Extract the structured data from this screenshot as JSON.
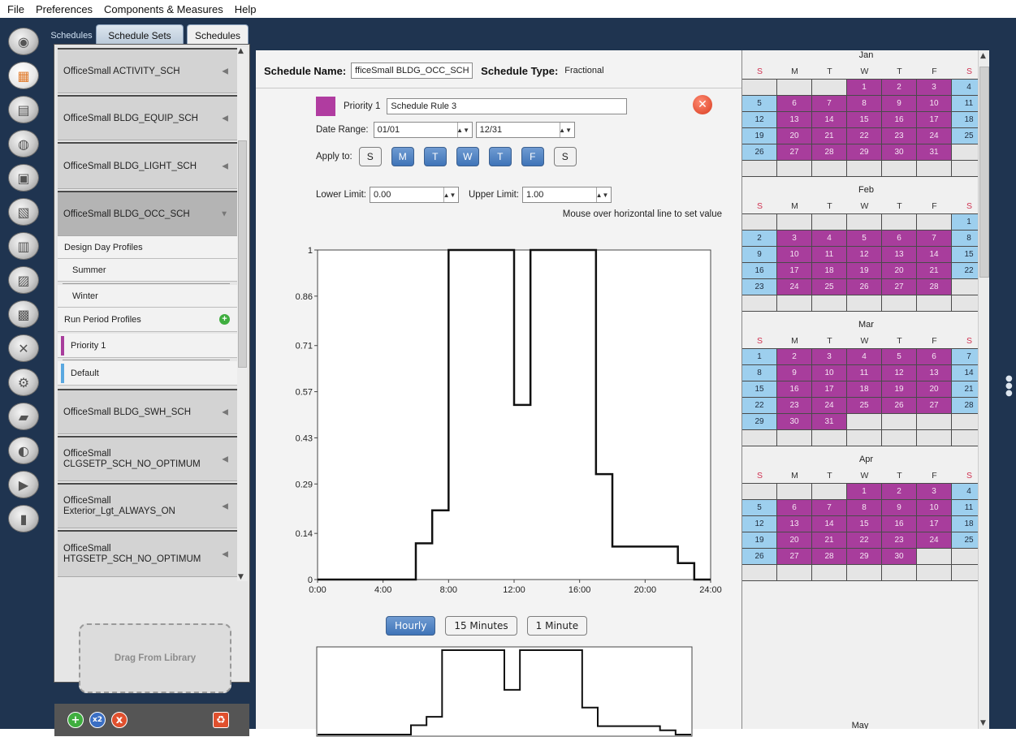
{
  "menu": [
    "File",
    "Preferences",
    "Components & Measures",
    "Help"
  ],
  "tabs": {
    "top_label": "Schedules",
    "schedule_sets": "Schedule Sets",
    "schedules": "Schedules"
  },
  "nav_icons": [
    "site-icon",
    "schedules-icon",
    "constructions-icon",
    "loads-icon",
    "space-types-icon",
    "geometry-icon",
    "facility-icon",
    "spaces-icon",
    "thermal-zones-icon",
    "hvac-systems-icon",
    "outputs-icon",
    "simulation-settings-icon",
    "measures-icon",
    "run-icon",
    "results-icon"
  ],
  "schedule_list": {
    "items_before": [
      {
        "label": "OfficeSmall ACTIVITY_SCH"
      },
      {
        "label": "OfficeSmall BLDG_EQUIP_SCH"
      },
      {
        "label": "OfficeSmall BLDG_LIGHT_SCH"
      }
    ],
    "selected": {
      "label": "OfficeSmall BLDG_OCC_SCH"
    },
    "design_day_header": "Design Day Profiles",
    "summer": "Summer",
    "winter": "Winter",
    "run_period_header": "Run Period Profiles",
    "priority_item": "Priority 1",
    "default_item": "Default",
    "items_after": [
      {
        "label": "OfficeSmall BLDG_SWH_SCH"
      },
      {
        "label": "OfficeSmall\nCLGSETP_SCH_NO_OPTIMUM"
      },
      {
        "label": "OfficeSmall\nExterior_Lgt_ALWAYS_ON"
      },
      {
        "label": "OfficeSmall\nHTGSETP_SCH_NO_OPTIMUM"
      }
    ],
    "drop_area": "Drag From Library",
    "bottom_buttons": {
      "add": "+",
      "copy": "x2",
      "remove": "x",
      "purge": "♻"
    }
  },
  "editor": {
    "schedule_name_label": "Schedule Name:",
    "schedule_name_value": "fficeSmall BLDG_OCC_SCH",
    "schedule_type_label": "Schedule Type:",
    "schedule_type_value": "Fractional",
    "priority_label": "Priority 1",
    "rule_name": "Schedule Rule 3",
    "rule_color": "#b03ca0",
    "date_range_label": "Date Range:",
    "date_start": "01/01",
    "date_end": "12/31",
    "apply_to_label": "Apply to:",
    "days": [
      {
        "label": "S",
        "on": false
      },
      {
        "label": "M",
        "on": true
      },
      {
        "label": "T",
        "on": true
      },
      {
        "label": "W",
        "on": true
      },
      {
        "label": "T",
        "on": true
      },
      {
        "label": "F",
        "on": true
      },
      {
        "label": "S",
        "on": false
      }
    ],
    "lower_limit_label": "Lower Limit:",
    "lower_limit": "0.00",
    "upper_limit_label": "Upper Limit:",
    "upper_limit": "1.00",
    "hint": "Mouse over horizontal line to set value",
    "resolution_buttons": [
      {
        "label": "Hourly",
        "on": true
      },
      {
        "label": "15 Minutes",
        "on": false
      },
      {
        "label": "1 Minute",
        "on": false
      }
    ]
  },
  "chart_data": {
    "type": "line",
    "step": true,
    "x_tick_labels": [
      "0:00",
      "4:00",
      "8:00",
      "12:00",
      "16:00",
      "20:00",
      "24:00"
    ],
    "y_tick_labels": [
      "0",
      "0.14",
      "0.29",
      "0.43",
      "0.57",
      "0.71",
      "0.86",
      "1"
    ],
    "xlim": [
      0,
      24
    ],
    "ylim": [
      0,
      1
    ],
    "series": [
      {
        "x": [
          0,
          6,
          7,
          8,
          12,
          13,
          17,
          18,
          22,
          23,
          24
        ],
        "y": [
          0,
          0.11,
          0.21,
          1.0,
          0.53,
          1.0,
          0.32,
          0.1,
          0.05,
          0.0,
          0.0
        ]
      }
    ]
  },
  "calendar": {
    "dow": [
      "S",
      "M",
      "T",
      "W",
      "T",
      "F",
      "S"
    ],
    "months": [
      {
        "name": "Jan",
        "start_dow": 3,
        "days": 31
      },
      {
        "name": "Feb",
        "start_dow": 6,
        "days": 28
      },
      {
        "name": "Mar",
        "start_dow": 0,
        "days": 31
      },
      {
        "name": "Apr",
        "start_dow": 3,
        "days": 30
      }
    ],
    "next_month": "May",
    "priority_color": "#a83d9c",
    "default_color": "#9dcfee"
  }
}
